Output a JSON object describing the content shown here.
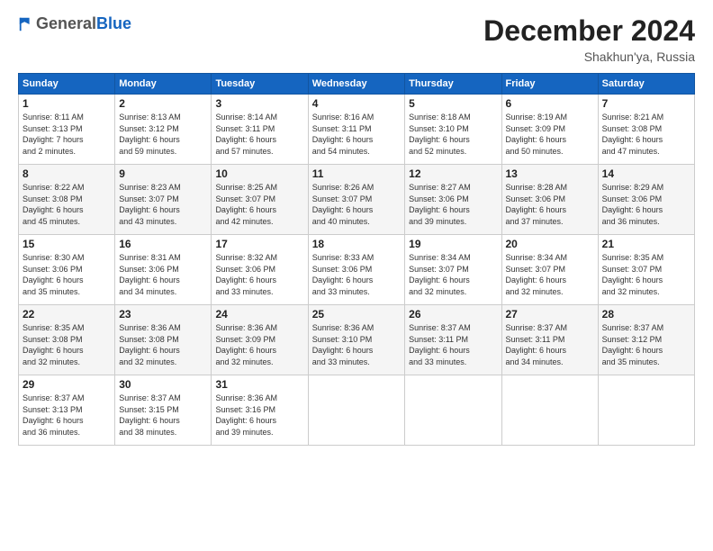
{
  "header": {
    "logo_general": "General",
    "logo_blue": "Blue",
    "month_title": "December 2024",
    "location": "Shakhun'ya, Russia"
  },
  "calendar": {
    "days_of_week": [
      "Sunday",
      "Monday",
      "Tuesday",
      "Wednesday",
      "Thursday",
      "Friday",
      "Saturday"
    ],
    "weeks": [
      [
        {
          "day": "1",
          "info": "Sunrise: 8:11 AM\nSunset: 3:13 PM\nDaylight: 7 hours\nand 2 minutes."
        },
        {
          "day": "2",
          "info": "Sunrise: 8:13 AM\nSunset: 3:12 PM\nDaylight: 6 hours\nand 59 minutes."
        },
        {
          "day": "3",
          "info": "Sunrise: 8:14 AM\nSunset: 3:11 PM\nDaylight: 6 hours\nand 57 minutes."
        },
        {
          "day": "4",
          "info": "Sunrise: 8:16 AM\nSunset: 3:11 PM\nDaylight: 6 hours\nand 54 minutes."
        },
        {
          "day": "5",
          "info": "Sunrise: 8:18 AM\nSunset: 3:10 PM\nDaylight: 6 hours\nand 52 minutes."
        },
        {
          "day": "6",
          "info": "Sunrise: 8:19 AM\nSunset: 3:09 PM\nDaylight: 6 hours\nand 50 minutes."
        },
        {
          "day": "7",
          "info": "Sunrise: 8:21 AM\nSunset: 3:08 PM\nDaylight: 6 hours\nand 47 minutes."
        }
      ],
      [
        {
          "day": "8",
          "info": "Sunrise: 8:22 AM\nSunset: 3:08 PM\nDaylight: 6 hours\nand 45 minutes."
        },
        {
          "day": "9",
          "info": "Sunrise: 8:23 AM\nSunset: 3:07 PM\nDaylight: 6 hours\nand 43 minutes."
        },
        {
          "day": "10",
          "info": "Sunrise: 8:25 AM\nSunset: 3:07 PM\nDaylight: 6 hours\nand 42 minutes."
        },
        {
          "day": "11",
          "info": "Sunrise: 8:26 AM\nSunset: 3:07 PM\nDaylight: 6 hours\nand 40 minutes."
        },
        {
          "day": "12",
          "info": "Sunrise: 8:27 AM\nSunset: 3:06 PM\nDaylight: 6 hours\nand 39 minutes."
        },
        {
          "day": "13",
          "info": "Sunrise: 8:28 AM\nSunset: 3:06 PM\nDaylight: 6 hours\nand 37 minutes."
        },
        {
          "day": "14",
          "info": "Sunrise: 8:29 AM\nSunset: 3:06 PM\nDaylight: 6 hours\nand 36 minutes."
        }
      ],
      [
        {
          "day": "15",
          "info": "Sunrise: 8:30 AM\nSunset: 3:06 PM\nDaylight: 6 hours\nand 35 minutes."
        },
        {
          "day": "16",
          "info": "Sunrise: 8:31 AM\nSunset: 3:06 PM\nDaylight: 6 hours\nand 34 minutes."
        },
        {
          "day": "17",
          "info": "Sunrise: 8:32 AM\nSunset: 3:06 PM\nDaylight: 6 hours\nand 33 minutes."
        },
        {
          "day": "18",
          "info": "Sunrise: 8:33 AM\nSunset: 3:06 PM\nDaylight: 6 hours\nand 33 minutes."
        },
        {
          "day": "19",
          "info": "Sunrise: 8:34 AM\nSunset: 3:07 PM\nDaylight: 6 hours\nand 32 minutes."
        },
        {
          "day": "20",
          "info": "Sunrise: 8:34 AM\nSunset: 3:07 PM\nDaylight: 6 hours\nand 32 minutes."
        },
        {
          "day": "21",
          "info": "Sunrise: 8:35 AM\nSunset: 3:07 PM\nDaylight: 6 hours\nand 32 minutes."
        }
      ],
      [
        {
          "day": "22",
          "info": "Sunrise: 8:35 AM\nSunset: 3:08 PM\nDaylight: 6 hours\nand 32 minutes."
        },
        {
          "day": "23",
          "info": "Sunrise: 8:36 AM\nSunset: 3:08 PM\nDaylight: 6 hours\nand 32 minutes."
        },
        {
          "day": "24",
          "info": "Sunrise: 8:36 AM\nSunset: 3:09 PM\nDaylight: 6 hours\nand 32 minutes."
        },
        {
          "day": "25",
          "info": "Sunrise: 8:36 AM\nSunset: 3:10 PM\nDaylight: 6 hours\nand 33 minutes."
        },
        {
          "day": "26",
          "info": "Sunrise: 8:37 AM\nSunset: 3:11 PM\nDaylight: 6 hours\nand 33 minutes."
        },
        {
          "day": "27",
          "info": "Sunrise: 8:37 AM\nSunset: 3:11 PM\nDaylight: 6 hours\nand 34 minutes."
        },
        {
          "day": "28",
          "info": "Sunrise: 8:37 AM\nSunset: 3:12 PM\nDaylight: 6 hours\nand 35 minutes."
        }
      ],
      [
        {
          "day": "29",
          "info": "Sunrise: 8:37 AM\nSunset: 3:13 PM\nDaylight: 6 hours\nand 36 minutes."
        },
        {
          "day": "30",
          "info": "Sunrise: 8:37 AM\nSunset: 3:15 PM\nDaylight: 6 hours\nand 38 minutes."
        },
        {
          "day": "31",
          "info": "Sunrise: 8:36 AM\nSunset: 3:16 PM\nDaylight: 6 hours\nand 39 minutes."
        },
        null,
        null,
        null,
        null
      ]
    ]
  }
}
